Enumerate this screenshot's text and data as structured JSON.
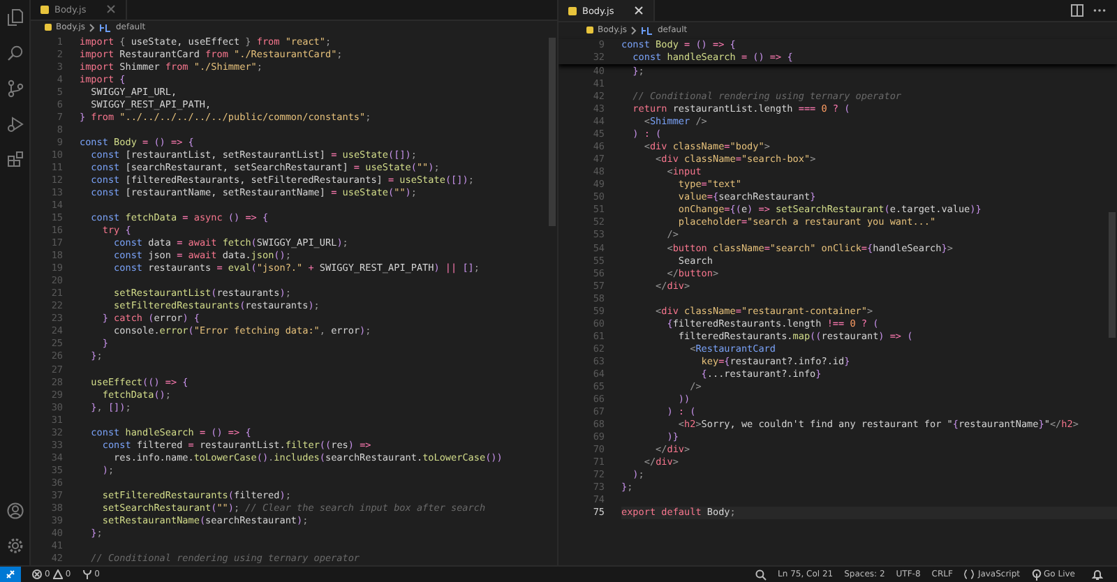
{
  "panes": [
    {
      "tab": {
        "label": "Body.js",
        "selected": false
      },
      "breadcrumb": {
        "file": "Body.js",
        "symbol": "default"
      },
      "lines": [
        {
          "n": "1",
          "tokens": [
            {
              "kind": "kw",
              "text": "import"
            },
            {
              "kind": "pun",
              "text": " { "
            },
            {
              "kind": "id",
              "text": "useState, useEffect"
            },
            {
              "kind": "pun",
              "text": " } "
            },
            {
              "kind": "kw",
              "text": "from"
            },
            {
              "kind": "str",
              "text": " \"react\""
            },
            {
              "kind": "pun",
              "text": ";"
            }
          ]
        },
        {
          "n": "2",
          "tokens": [
            {
              "kind": "kw",
              "text": "import"
            },
            {
              "kind": "id",
              "text": " RestaurantCard "
            },
            {
              "kind": "kw",
              "text": "from"
            },
            {
              "kind": "str",
              "text": " \"./RestaurantCard\""
            },
            {
              "kind": "pun",
              "text": ";"
            }
          ]
        },
        {
          "n": "3",
          "tokens": [
            {
              "kind": "kw",
              "text": "import"
            },
            {
              "kind": "id",
              "text": " Shimmer "
            },
            {
              "kind": "kw",
              "text": "from"
            },
            {
              "kind": "str",
              "text": " \"./Shimmer\""
            },
            {
              "kind": "pun",
              "text": ";"
            }
          ]
        },
        {
          "n": "4",
          "tokens": [
            {
              "kind": "kw",
              "text": "import"
            },
            {
              "kind": "br",
              "text": " {"
            }
          ]
        },
        {
          "n": "5",
          "tokens": [
            {
              "kind": "id",
              "text": "  SWIGGY_API_URL,"
            }
          ]
        },
        {
          "n": "6",
          "tokens": [
            {
              "kind": "id",
              "text": "  SWIGGY_REST_API_PATH,"
            }
          ]
        },
        {
          "n": "7",
          "tokens": [
            {
              "kind": "br",
              "text": "}"
            },
            {
              "kind": "kw",
              "text": " from"
            },
            {
              "kind": "str",
              "text": " \"../../../../../../public/common/constants\""
            },
            {
              "kind": "pun",
              "text": ";"
            }
          ]
        },
        {
          "n": "8"
        },
        {
          "n": "9",
          "tokens": [
            {
              "kind": "decl",
              "text": "const"
            },
            {
              "kind": "fn",
              "text": " Body"
            },
            {
              "kind": "op",
              "text": " ="
            },
            {
              "kind": "br",
              "text": " ()"
            },
            {
              "kind": "op",
              "text": " =>"
            },
            {
              "kind": "br",
              "text": " {"
            }
          ]
        },
        {
          "n": "10",
          "tokens": [
            {
              "kind": "decl",
              "text": "  const"
            },
            {
              "kind": "id",
              "text": " [restaurantList, setRestaurantList]"
            },
            {
              "kind": "op",
              "text": " ="
            },
            {
              "kind": "fn",
              "text": " useState"
            },
            {
              "kind": "br",
              "text": "([])"
            },
            {
              "kind": "pun",
              "text": ";"
            }
          ]
        },
        {
          "n": "11",
          "tokens": [
            {
              "kind": "decl",
              "text": "  const"
            },
            {
              "kind": "id",
              "text": " [searchRestaurant, setSearchRestaurant]"
            },
            {
              "kind": "op",
              "text": " ="
            },
            {
              "kind": "fn",
              "text": " useState"
            },
            {
              "kind": "br",
              "text": "("
            },
            {
              "kind": "str",
              "text": "\"\""
            },
            {
              "kind": "br",
              "text": ")"
            },
            {
              "kind": "pun",
              "text": ";"
            }
          ]
        },
        {
          "n": "12",
          "tokens": [
            {
              "kind": "decl",
              "text": "  const"
            },
            {
              "kind": "id",
              "text": " [filteredRestaurants, setFilteredRestaurants]"
            },
            {
              "kind": "op",
              "text": " ="
            },
            {
              "kind": "fn",
              "text": " useState"
            },
            {
              "kind": "br",
              "text": "([])"
            },
            {
              "kind": "pun",
              "text": ";"
            }
          ]
        },
        {
          "n": "13",
          "tokens": [
            {
              "kind": "decl",
              "text": "  const"
            },
            {
              "kind": "id",
              "text": " [restaurantName, setRestaurantName]"
            },
            {
              "kind": "op",
              "text": " ="
            },
            {
              "kind": "fn",
              "text": " useState"
            },
            {
              "kind": "br",
              "text": "("
            },
            {
              "kind": "str",
              "text": "\"\""
            },
            {
              "kind": "br",
              "text": ")"
            },
            {
              "kind": "pun",
              "text": ";"
            }
          ]
        },
        {
          "n": "14"
        },
        {
          "n": "15",
          "tokens": [
            {
              "kind": "decl",
              "text": "  const"
            },
            {
              "kind": "fn",
              "text": " fetchData"
            },
            {
              "kind": "op",
              "text": " ="
            },
            {
              "kind": "kw",
              "text": " async"
            },
            {
              "kind": "br",
              "text": " ()"
            },
            {
              "kind": "op",
              "text": " =>"
            },
            {
              "kind": "br",
              "text": " {"
            }
          ]
        },
        {
          "n": "16",
          "tokens": [
            {
              "kind": "kw",
              "text": "    try"
            },
            {
              "kind": "br",
              "text": " {"
            }
          ]
        },
        {
          "n": "17",
          "tokens": [
            {
              "kind": "decl",
              "text": "      const"
            },
            {
              "kind": "id",
              "text": " data"
            },
            {
              "kind": "op",
              "text": " ="
            },
            {
              "kind": "kw",
              "text": " await"
            },
            {
              "kind": "fn",
              "text": " fetch"
            },
            {
              "kind": "br",
              "text": "("
            },
            {
              "kind": "id",
              "text": "SWIGGY_API_URL"
            },
            {
              "kind": "br",
              "text": ")"
            },
            {
              "kind": "pun",
              "text": ";"
            }
          ]
        },
        {
          "n": "18",
          "tokens": [
            {
              "kind": "decl",
              "text": "      const"
            },
            {
              "kind": "id",
              "text": " json"
            },
            {
              "kind": "op",
              "text": " ="
            },
            {
              "kind": "kw",
              "text": " await"
            },
            {
              "kind": "id",
              "text": " data."
            },
            {
              "kind": "fn",
              "text": "json"
            },
            {
              "kind": "br",
              "text": "()"
            },
            {
              "kind": "pun",
              "text": ";"
            }
          ]
        },
        {
          "n": "19",
          "tokens": [
            {
              "kind": "decl",
              "text": "      const"
            },
            {
              "kind": "id",
              "text": " restaurants"
            },
            {
              "kind": "op",
              "text": " ="
            },
            {
              "kind": "fn",
              "text": " eval"
            },
            {
              "kind": "br",
              "text": "("
            },
            {
              "kind": "str",
              "text": "\"json?.\""
            },
            {
              "kind": "op",
              "text": " +"
            },
            {
              "kind": "id",
              "text": " SWIGGY_REST_API_PATH"
            },
            {
              "kind": "br",
              "text": ")"
            },
            {
              "kind": "op",
              "text": " ||"
            },
            {
              "kind": "br",
              "text": " []"
            },
            {
              "kind": "pun",
              "text": ";"
            }
          ]
        },
        {
          "n": "20"
        },
        {
          "n": "21",
          "tokens": [
            {
              "kind": "fn",
              "text": "      setRestaurantList"
            },
            {
              "kind": "br",
              "text": "("
            },
            {
              "kind": "id",
              "text": "restaurants"
            },
            {
              "kind": "br",
              "text": ")"
            },
            {
              "kind": "pun",
              "text": ";"
            }
          ]
        },
        {
          "n": "22",
          "tokens": [
            {
              "kind": "fn",
              "text": "      setFilteredRestaurants"
            },
            {
              "kind": "br",
              "text": "("
            },
            {
              "kind": "id",
              "text": "restaurants"
            },
            {
              "kind": "br",
              "text": ")"
            },
            {
              "kind": "pun",
              "text": ";"
            }
          ]
        },
        {
          "n": "23",
          "tokens": [
            {
              "kind": "br",
              "text": "    }"
            },
            {
              "kind": "kw",
              "text": " catch"
            },
            {
              "kind": "br",
              "text": " ("
            },
            {
              "kind": "id",
              "text": "error"
            },
            {
              "kind": "br",
              "text": ")"
            },
            {
              "kind": "br",
              "text": " {"
            }
          ]
        },
        {
          "n": "24",
          "tokens": [
            {
              "kind": "id",
              "text": "      console."
            },
            {
              "kind": "fn",
              "text": "error"
            },
            {
              "kind": "br",
              "text": "("
            },
            {
              "kind": "str",
              "text": "\"Error fetching data:\""
            },
            {
              "kind": "pun",
              "text": ", "
            },
            {
              "kind": "id",
              "text": "error"
            },
            {
              "kind": "br",
              "text": ")"
            },
            {
              "kind": "pun",
              "text": ";"
            }
          ]
        },
        {
          "n": "25",
          "tokens": [
            {
              "kind": "br",
              "text": "    }"
            }
          ]
        },
        {
          "n": "26",
          "tokens": [
            {
              "kind": "br",
              "text": "  }"
            },
            {
              "kind": "pun",
              "text": ";"
            }
          ]
        },
        {
          "n": "27"
        },
        {
          "n": "28",
          "tokens": [
            {
              "kind": "fn",
              "text": "  useEffect"
            },
            {
              "kind": "br",
              "text": "(()"
            },
            {
              "kind": "op",
              "text": " =>"
            },
            {
              "kind": "br",
              "text": " {"
            }
          ]
        },
        {
          "n": "29",
          "tokens": [
            {
              "kind": "fn",
              "text": "    fetchData"
            },
            {
              "kind": "br",
              "text": "()"
            },
            {
              "kind": "pun",
              "text": ";"
            }
          ]
        },
        {
          "n": "30",
          "tokens": [
            {
              "kind": "br",
              "text": "  }"
            },
            {
              "kind": "pun",
              "text": ", "
            },
            {
              "kind": "br",
              "text": "[])"
            },
            {
              "kind": "pun",
              "text": ";"
            }
          ]
        },
        {
          "n": "31"
        },
        {
          "n": "32",
          "tokens": [
            {
              "kind": "decl",
              "text": "  const"
            },
            {
              "kind": "fn",
              "text": " handleSearch"
            },
            {
              "kind": "op",
              "text": " ="
            },
            {
              "kind": "br",
              "text": " ()"
            },
            {
              "kind": "op",
              "text": " =>"
            },
            {
              "kind": "br",
              "text": " {"
            }
          ]
        },
        {
          "n": "33",
          "tokens": [
            {
              "kind": "decl",
              "text": "    const"
            },
            {
              "kind": "id",
              "text": " filtered"
            },
            {
              "kind": "op",
              "text": " ="
            },
            {
              "kind": "id",
              "text": " restaurantList."
            },
            {
              "kind": "fn",
              "text": "filter"
            },
            {
              "kind": "br",
              "text": "(("
            },
            {
              "kind": "id",
              "text": "res"
            },
            {
              "kind": "br",
              "text": ")"
            },
            {
              "kind": "op",
              "text": " =>"
            }
          ]
        },
        {
          "n": "34",
          "tokens": [
            {
              "kind": "id",
              "text": "      res.info.name."
            },
            {
              "kind": "fn",
              "text": "toLowerCase"
            },
            {
              "kind": "br",
              "text": "()"
            },
            {
              "kind": "pun",
              "text": "."
            },
            {
              "kind": "fn",
              "text": "includes"
            },
            {
              "kind": "br",
              "text": "("
            },
            {
              "kind": "id",
              "text": "searchRestaurant."
            },
            {
              "kind": "fn",
              "text": "toLowerCase"
            },
            {
              "kind": "br",
              "text": "())"
            }
          ]
        },
        {
          "n": "35",
          "tokens": [
            {
              "kind": "br",
              "text": "    )"
            },
            {
              "kind": "pun",
              "text": ";"
            }
          ]
        },
        {
          "n": "36"
        },
        {
          "n": "37",
          "tokens": [
            {
              "kind": "fn",
              "text": "    setFilteredRestaurants"
            },
            {
              "kind": "br",
              "text": "("
            },
            {
              "kind": "id",
              "text": "filtered"
            },
            {
              "kind": "br",
              "text": ")"
            },
            {
              "kind": "pun",
              "text": ";"
            }
          ]
        },
        {
          "n": "38",
          "tokens": [
            {
              "kind": "fn",
              "text": "    setSearchRestaurant"
            },
            {
              "kind": "br",
              "text": "("
            },
            {
              "kind": "str",
              "text": "\"\""
            },
            {
              "kind": "br",
              "text": ")"
            },
            {
              "kind": "pun",
              "text": ";"
            },
            {
              "kind": "cmt",
              "text": " // Clear the search input box after search"
            }
          ]
        },
        {
          "n": "39",
          "tokens": [
            {
              "kind": "fn",
              "text": "    setRestaurantName"
            },
            {
              "kind": "br",
              "text": "("
            },
            {
              "kind": "id",
              "text": "searchRestaurant"
            },
            {
              "kind": "br",
              "text": ")"
            },
            {
              "kind": "pun",
              "text": ";"
            }
          ]
        },
        {
          "n": "40",
          "tokens": [
            {
              "kind": "br",
              "text": "  }"
            },
            {
              "kind": "pun",
              "text": ";"
            }
          ]
        },
        {
          "n": "41"
        },
        {
          "n": "42",
          "tokens": [
            {
              "kind": "cmt",
              "text": "  // Conditional rendering using ternary operator"
            }
          ]
        }
      ]
    },
    {
      "tab": {
        "label": "Body.js",
        "selected": true
      },
      "breadcrumb": {
        "file": "Body.js",
        "symbol": "default"
      },
      "sticky": [
        {
          "n": "9",
          "tokens": [
            {
              "kind": "decl",
              "text": "const"
            },
            {
              "kind": "fn",
              "text": " Body"
            },
            {
              "kind": "op",
              "text": " ="
            },
            {
              "kind": "br",
              "text": " ()"
            },
            {
              "kind": "op",
              "text": " =>"
            },
            {
              "kind": "br",
              "text": " {"
            }
          ]
        },
        {
          "n": "32",
          "tokens": [
            {
              "kind": "decl",
              "text": "  const"
            },
            {
              "kind": "fn",
              "text": " handleSearch"
            },
            {
              "kind": "op",
              "text": " ="
            },
            {
              "kind": "br",
              "text": " ()"
            },
            {
              "kind": "op",
              "text": " =>"
            },
            {
              "kind": "br",
              "text": " {"
            }
          ]
        }
      ],
      "lines": [
        {
          "n": "40",
          "active": false,
          "tokens": [
            {
              "kind": "br",
              "text": "  }"
            },
            {
              "kind": "pun",
              "text": ";"
            }
          ]
        },
        {
          "n": "41",
          "active": false
        },
        {
          "n": "42",
          "active": false,
          "tokens": [
            {
              "kind": "cmt",
              "text": "  // Conditional rendering using ternary operator"
            }
          ]
        },
        {
          "n": "43",
          "active": false,
          "tokens": [
            {
              "kind": "kw",
              "text": "  return"
            },
            {
              "kind": "id",
              "text": " restaurantList.length"
            },
            {
              "kind": "op",
              "text": " ==="
            },
            {
              "kind": "num",
              "text": " 0"
            },
            {
              "kind": "op",
              "text": " ?"
            },
            {
              "kind": "br",
              "text": " ("
            }
          ]
        },
        {
          "n": "44",
          "active": false,
          "tokens": [
            {
              "kind": "pun",
              "text": "    <"
            },
            {
              "kind": "comp",
              "text": "Shimmer"
            },
            {
              "kind": "pun",
              "text": " />"
            }
          ]
        },
        {
          "n": "45",
          "active": false,
          "tokens": [
            {
              "kind": "br",
              "text": "  )"
            },
            {
              "kind": "op",
              "text": " :"
            },
            {
              "kind": "br",
              "text": " ("
            }
          ]
        },
        {
          "n": "46",
          "active": false,
          "tokens": [
            {
              "kind": "pun",
              "text": "    <"
            },
            {
              "kind": "tag",
              "text": "div"
            },
            {
              "kind": "attr",
              "text": " className"
            },
            {
              "kind": "op",
              "text": "="
            },
            {
              "kind": "str",
              "text": "\"body\""
            },
            {
              "kind": "pun",
              "text": ">"
            }
          ]
        },
        {
          "n": "47",
          "active": false,
          "tokens": [
            {
              "kind": "pun",
              "text": "      <"
            },
            {
              "kind": "tag",
              "text": "div"
            },
            {
              "kind": "attr",
              "text": " className"
            },
            {
              "kind": "op",
              "text": "="
            },
            {
              "kind": "str",
              "text": "\"search-box\""
            },
            {
              "kind": "pun",
              "text": ">"
            }
          ]
        },
        {
          "n": "48",
          "active": false,
          "tokens": [
            {
              "kind": "pun",
              "text": "        <"
            },
            {
              "kind": "tag",
              "text": "input"
            }
          ]
        },
        {
          "n": "49",
          "active": false,
          "tokens": [
            {
              "kind": "attr",
              "text": "          type"
            },
            {
              "kind": "op",
              "text": "="
            },
            {
              "kind": "str",
              "text": "\"text\""
            }
          ]
        },
        {
          "n": "50",
          "active": false,
          "tokens": [
            {
              "kind": "attr",
              "text": "          value"
            },
            {
              "kind": "op",
              "text": "="
            },
            {
              "kind": "br",
              "text": "{"
            },
            {
              "kind": "id",
              "text": "searchRestaurant"
            },
            {
              "kind": "br",
              "text": "}"
            }
          ]
        },
        {
          "n": "51",
          "active": false,
          "tokens": [
            {
              "kind": "attr",
              "text": "          onChange"
            },
            {
              "kind": "op",
              "text": "="
            },
            {
              "kind": "br",
              "text": "{("
            },
            {
              "kind": "id",
              "text": "e"
            },
            {
              "kind": "br",
              "text": ")"
            },
            {
              "kind": "op",
              "text": " =>"
            },
            {
              "kind": "fn",
              "text": " setSearchRestaurant"
            },
            {
              "kind": "br",
              "text": "("
            },
            {
              "kind": "id",
              "text": "e.target.value"
            },
            {
              "kind": "br",
              "text": ")}"
            }
          ]
        },
        {
          "n": "52",
          "active": false,
          "tokens": [
            {
              "kind": "attr",
              "text": "          placeholder"
            },
            {
              "kind": "op",
              "text": "="
            },
            {
              "kind": "str",
              "text": "\"search a restaurant you want...\""
            }
          ]
        },
        {
          "n": "53",
          "active": false,
          "tokens": [
            {
              "kind": "pun",
              "text": "        />"
            }
          ]
        },
        {
          "n": "54",
          "active": false,
          "tokens": [
            {
              "kind": "pun",
              "text": "        <"
            },
            {
              "kind": "tag",
              "text": "button"
            },
            {
              "kind": "attr",
              "text": " className"
            },
            {
              "kind": "op",
              "text": "="
            },
            {
              "kind": "str",
              "text": "\"search\""
            },
            {
              "kind": "attr",
              "text": " onClick"
            },
            {
              "kind": "op",
              "text": "="
            },
            {
              "kind": "br",
              "text": "{"
            },
            {
              "kind": "id",
              "text": "handleSearch"
            },
            {
              "kind": "br",
              "text": "}"
            },
            {
              "kind": "pun",
              "text": ">"
            }
          ]
        },
        {
          "n": "55",
          "active": false,
          "tokens": [
            {
              "kind": "id",
              "text": "          Search"
            }
          ]
        },
        {
          "n": "56",
          "active": false,
          "tokens": [
            {
              "kind": "pun",
              "text": "        </"
            },
            {
              "kind": "tag",
              "text": "button"
            },
            {
              "kind": "pun",
              "text": ">"
            }
          ]
        },
        {
          "n": "57",
          "active": false,
          "tokens": [
            {
              "kind": "pun",
              "text": "      </"
            },
            {
              "kind": "tag",
              "text": "div"
            },
            {
              "kind": "pun",
              "text": ">"
            }
          ]
        },
        {
          "n": "58",
          "active": false
        },
        {
          "n": "59",
          "active": false,
          "tokens": [
            {
              "kind": "pun",
              "text": "      <"
            },
            {
              "kind": "tag",
              "text": "div"
            },
            {
              "kind": "attr",
              "text": " className"
            },
            {
              "kind": "op",
              "text": "="
            },
            {
              "kind": "str",
              "text": "\"restaurant-container\""
            },
            {
              "kind": "pun",
              "text": ">"
            }
          ]
        },
        {
          "n": "60",
          "active": false,
          "tokens": [
            {
              "kind": "br",
              "text": "        {"
            },
            {
              "kind": "id",
              "text": "filteredRestaurants.length"
            },
            {
              "kind": "op",
              "text": " !=="
            },
            {
              "kind": "num",
              "text": " 0"
            },
            {
              "kind": "op",
              "text": " ?"
            },
            {
              "kind": "br",
              "text": " ("
            }
          ]
        },
        {
          "n": "61",
          "active": false,
          "tokens": [
            {
              "kind": "id",
              "text": "          filteredRestaurants."
            },
            {
              "kind": "fn",
              "text": "map"
            },
            {
              "kind": "br",
              "text": "(("
            },
            {
              "kind": "id",
              "text": "restaurant"
            },
            {
              "kind": "br",
              "text": ")"
            },
            {
              "kind": "op",
              "text": " =>"
            },
            {
              "kind": "br",
              "text": " ("
            }
          ]
        },
        {
          "n": "62",
          "active": false,
          "tokens": [
            {
              "kind": "pun",
              "text": "            <"
            },
            {
              "kind": "comp",
              "text": "RestaurantCard"
            }
          ]
        },
        {
          "n": "63",
          "active": false,
          "tokens": [
            {
              "kind": "attr",
              "text": "              key"
            },
            {
              "kind": "op",
              "text": "="
            },
            {
              "kind": "br",
              "text": "{"
            },
            {
              "kind": "id",
              "text": "restaurant?.info?.id"
            },
            {
              "kind": "br",
              "text": "}"
            }
          ]
        },
        {
          "n": "64",
          "active": false,
          "tokens": [
            {
              "kind": "br",
              "text": "              {"
            },
            {
              "kind": "id",
              "text": "...restaurant?.info"
            },
            {
              "kind": "br",
              "text": "}"
            }
          ]
        },
        {
          "n": "65",
          "active": false,
          "tokens": [
            {
              "kind": "pun",
              "text": "            />"
            }
          ]
        },
        {
          "n": "66",
          "active": false,
          "tokens": [
            {
              "kind": "br",
              "text": "          ))"
            }
          ]
        },
        {
          "n": "67",
          "active": false,
          "tokens": [
            {
              "kind": "br",
              "text": "        )"
            },
            {
              "kind": "op",
              "text": " :"
            },
            {
              "kind": "br",
              "text": " ("
            }
          ]
        },
        {
          "n": "68",
          "active": false,
          "tokens": [
            {
              "kind": "pun",
              "text": "          <"
            },
            {
              "kind": "tag",
              "text": "h2"
            },
            {
              "kind": "pun",
              "text": ">"
            },
            {
              "kind": "id",
              "text": "Sorry, we couldn't find any restaurant for \""
            },
            {
              "kind": "br",
              "text": "{"
            },
            {
              "kind": "id",
              "text": "restaurantName"
            },
            {
              "kind": "br",
              "text": "}"
            },
            {
              "kind": "id",
              "text": "\""
            },
            {
              "kind": "pun",
              "text": "</"
            },
            {
              "kind": "tag",
              "text": "h2"
            },
            {
              "kind": "pun",
              "text": ">"
            }
          ]
        },
        {
          "n": "69",
          "active": false,
          "tokens": [
            {
              "kind": "br",
              "text": "        )}"
            }
          ]
        },
        {
          "n": "70",
          "active": false,
          "tokens": [
            {
              "kind": "pun",
              "text": "      </"
            },
            {
              "kind": "tag",
              "text": "div"
            },
            {
              "kind": "pun",
              "text": ">"
            }
          ]
        },
        {
          "n": "71",
          "active": false,
          "tokens": [
            {
              "kind": "pun",
              "text": "    </"
            },
            {
              "kind": "tag",
              "text": "div"
            },
            {
              "kind": "pun",
              "text": ">"
            }
          ]
        },
        {
          "n": "72",
          "active": false,
          "tokens": [
            {
              "kind": "br",
              "text": "  )"
            },
            {
              "kind": "pun",
              "text": ";"
            }
          ]
        },
        {
          "n": "73",
          "active": false,
          "tokens": [
            {
              "kind": "br",
              "text": "}"
            },
            {
              "kind": "pun",
              "text": ";"
            }
          ]
        },
        {
          "n": "74",
          "active": false
        },
        {
          "n": "75",
          "active": true,
          "tokens": [
            {
              "kind": "kw",
              "text": "export default"
            },
            {
              "kind": "id",
              "text": " Body"
            },
            {
              "kind": "pun",
              "text": ";"
            }
          ]
        }
      ]
    }
  ],
  "status_bar": {
    "errors": "0",
    "warnings": "0",
    "ports": "0",
    "items": [
      "Ln 75, Col 21",
      "Spaces: 2",
      "UTF-8",
      "CRLF"
    ],
    "language": "JavaScript",
    "go_live": "Go Live"
  }
}
